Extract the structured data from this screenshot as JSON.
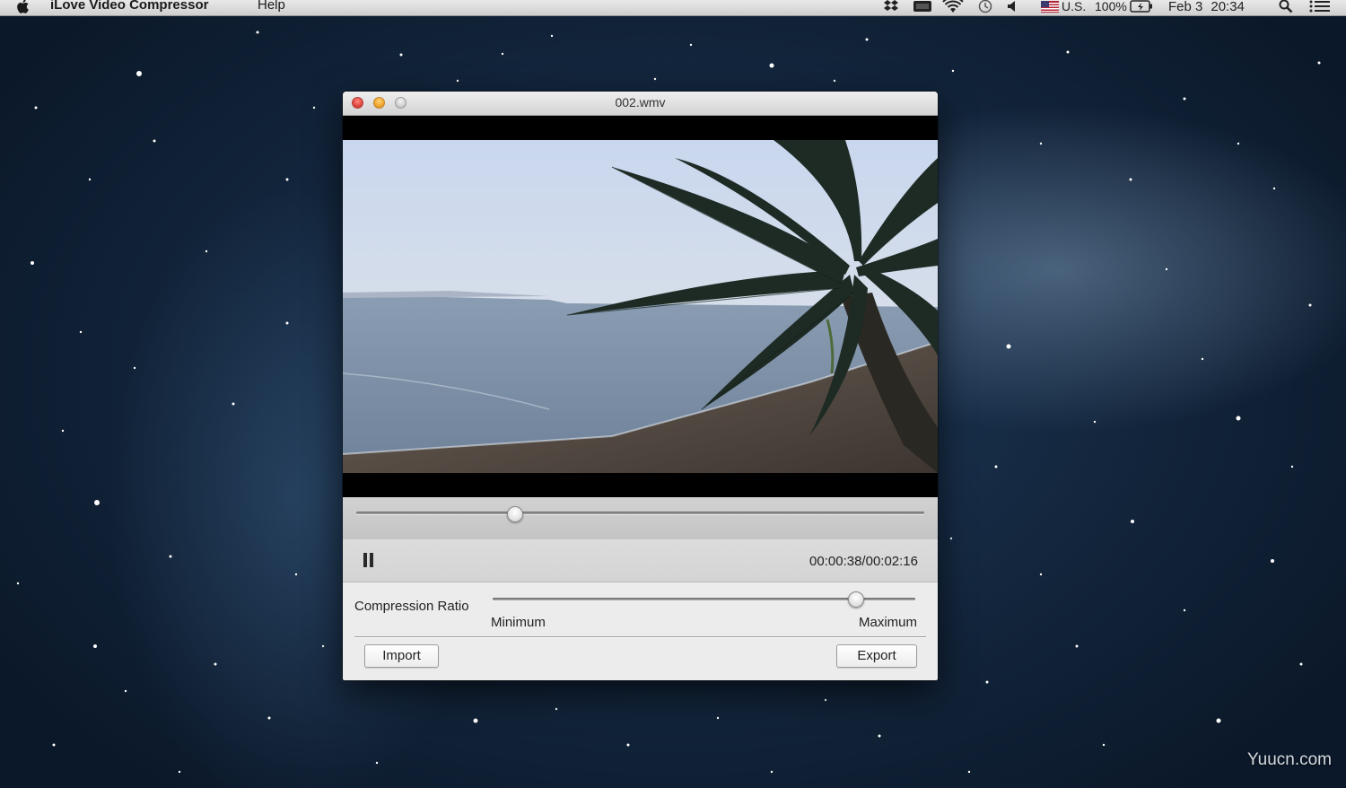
{
  "menubar": {
    "app_name": "iLove Video Compressor",
    "menus": [
      "Help"
    ],
    "input_source": "U.S.",
    "battery": "100%",
    "date": "Feb 3",
    "time": "20:34",
    "tray_icons": [
      "dropbox-icon",
      "display-icon",
      "wifi-icon",
      "time-machine-icon",
      "volume-icon",
      "us-flag-icon",
      "battery-icon",
      "spotlight-icon",
      "notification-center-icon"
    ]
  },
  "window": {
    "title": "002.wmv",
    "controls": [
      "close",
      "minimize",
      "zoom"
    ]
  },
  "player": {
    "playback_state": "playing",
    "pause_icon": "pause-icon",
    "current_time": "00:00:38",
    "total_time": "00:02:16",
    "time_display": "00:00:38/00:02:16",
    "progress": 0.28
  },
  "compression": {
    "label": "Compression Ratio",
    "min_label": "Minimum",
    "max_label": "Maximum",
    "value": 0.86
  },
  "buttons": {
    "import": "Import",
    "export": "Export"
  },
  "watermark": "Yuucn.com",
  "colors": {
    "close": "#e0443e",
    "minimize": "#f0a32c",
    "zoom": "#cfcfcf",
    "window_bg": "#ececec"
  }
}
